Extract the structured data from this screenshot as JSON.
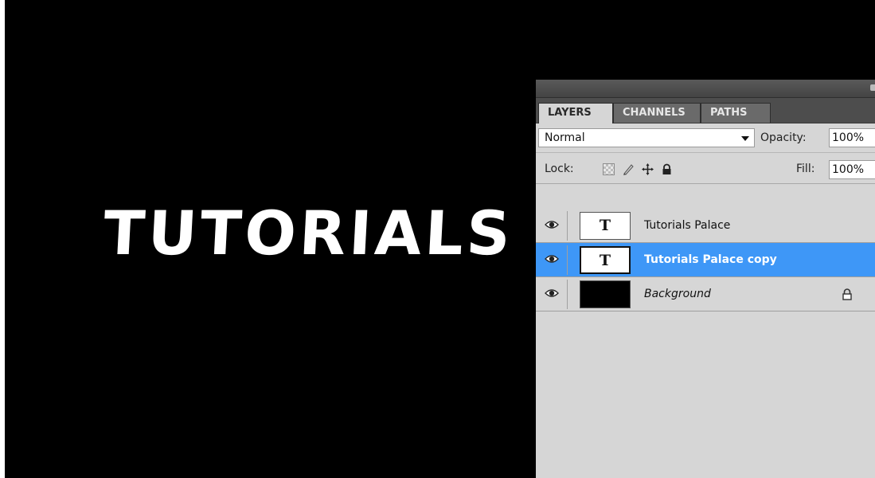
{
  "canvas": {
    "text": "TUTORIALS P",
    "background_color": "#000000",
    "text_color": "#ffffff"
  },
  "panel": {
    "tabs": [
      {
        "label": "LAYERS",
        "active": true
      },
      {
        "label": "CHANNELS",
        "active": false
      },
      {
        "label": "PATHS",
        "active": false
      }
    ],
    "blend_mode": "Normal",
    "opacity_label": "Opacity:",
    "opacity_value": "100%",
    "lock_label": "Lock:",
    "lock_icons": [
      "lock-transparent-icon",
      "lock-image-icon",
      "lock-position-icon",
      "lock-all-icon"
    ],
    "fill_label": "Fill:",
    "fill_value": "100%",
    "layers": [
      {
        "name": "Tutorials Palace",
        "thumbnail": "T",
        "visible": true,
        "selected": false
      },
      {
        "name": "Tutorials Palace copy",
        "thumbnail": "T",
        "visible": true,
        "selected": true
      },
      {
        "name": "Background",
        "thumbnail": "",
        "visible": true,
        "selected": false,
        "locked": true
      }
    ],
    "selection_color": "#3e97f7"
  }
}
